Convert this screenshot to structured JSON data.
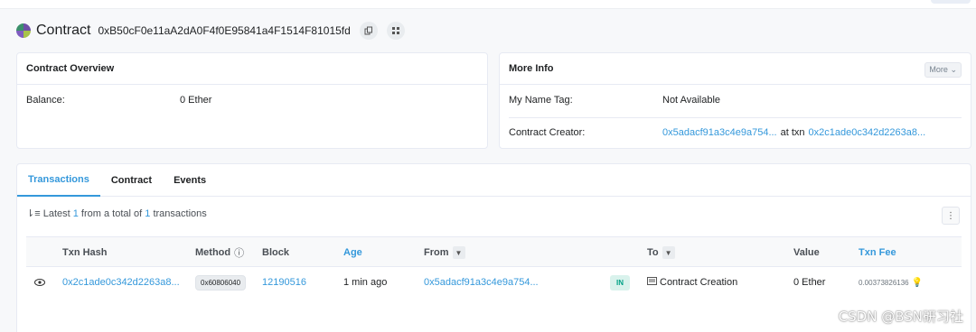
{
  "header": {
    "title": "Contract",
    "address": "0xB50cF0e11aA2dA0F4f0E95841a4F1514F81015fd",
    "copy_icon": "copy-icon",
    "qr_icon": "qr-code-icon"
  },
  "overview": {
    "title": "Contract Overview",
    "balance_label": "Balance:",
    "balance_value": "0 Ether"
  },
  "more_info": {
    "title": "More Info",
    "more_button": "More",
    "name_tag_label": "My Name Tag:",
    "name_tag_value": "Not Available",
    "creator_label": "Contract Creator:",
    "creator_address": "0x5adacf91a3c4e9a754...",
    "at_txn_label": "at txn",
    "creator_txn": "0x2c1ade0c342d2263a8..."
  },
  "tabs": [
    {
      "label": "Transactions",
      "active": true
    },
    {
      "label": "Contract",
      "active": false
    },
    {
      "label": "Events",
      "active": false
    }
  ],
  "summary": {
    "prefix": "Latest",
    "count": "1",
    "middle": "from a total of",
    "total": "1",
    "suffix": "transactions"
  },
  "table": {
    "columns": {
      "txn_hash": "Txn Hash",
      "method": "Method",
      "block": "Block",
      "age": "Age",
      "from": "From",
      "to": "To",
      "value": "Value",
      "txn_fee": "Txn Fee"
    },
    "rows": [
      {
        "txn_hash": "0x2c1ade0c342d2263a8...",
        "method": "0x60806040",
        "block": "12190516",
        "age": "1 min ago",
        "from": "0x5adacf91a3c4e9a754...",
        "direction": "IN",
        "to": "Contract Creation",
        "value": "0 Ether",
        "txn_fee": "0.00373826136"
      }
    ]
  },
  "watermark": "CSDN @BSN研习社",
  "colors": {
    "link": "#3498db",
    "in_badge_bg": "#d9f2ec",
    "in_badge_text": "#00a186",
    "page_bg": "#f7f8fa"
  }
}
